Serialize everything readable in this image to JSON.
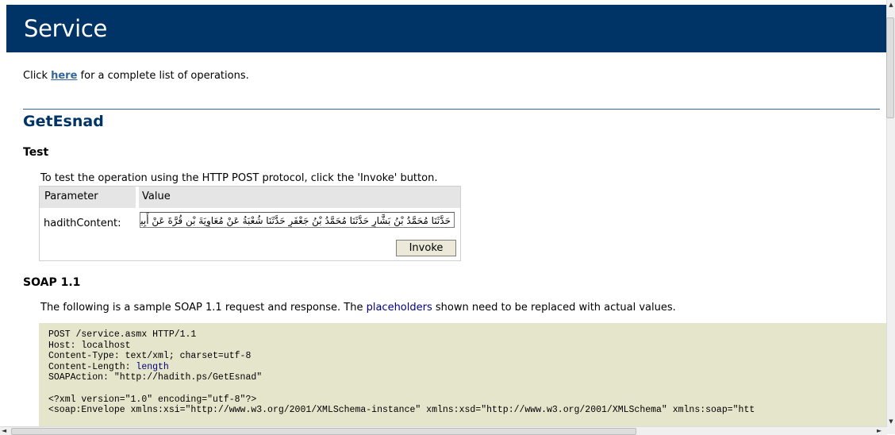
{
  "page": {
    "title": "Service",
    "intro": {
      "prefix": "Click ",
      "link": "here",
      "suffix": " for a complete list of operations."
    },
    "operation": "GetEsnad"
  },
  "test": {
    "heading": "Test",
    "description": "To test the operation using the HTTP POST protocol, click the 'Invoke' button.",
    "table": {
      "col_parameter": "Parameter",
      "col_value": "Value",
      "param_label": "hadithContent:",
      "param_value": "حَدَّثَنَا مُحَمَّدُ بْنُ بَشَّارٍ حَدَّثَنَا مُحَمَّدُ بْنُ جَعْفَرٍ حَدَّثَنَا شُعْبَةُ عَنْ مُعَاوِيَةَ بْنِ قُرَّةَ عَنْ أَبِيهِ."
    },
    "invoke_label": "Invoke"
  },
  "soap": {
    "heading": "SOAP 1.1",
    "desc_prefix": "The following is a sample SOAP 1.1 request and response. The ",
    "desc_link": "placeholders",
    "desc_suffix": " shown need to be replaced with actual values.",
    "code": {
      "line1": "POST /service.asmx HTTP/1.1",
      "line2": "Host: localhost",
      "line3": "Content-Type: text/xml; charset=utf-8",
      "line4_prefix": "Content-Length: ",
      "line4_value": "length",
      "line5": "SOAPAction: \"http://hadith.ps/GetEsnad\"",
      "line6": "",
      "line7": "<?xml version=\"1.0\" encoding=\"utf-8\"?>",
      "line8": "<soap:Envelope xmlns:xsi=\"http://www.w3.org/2001/XMLSchema-instance\" xmlns:xsd=\"http://www.w3.org/2001/XMLSchema\" xmlns:soap=\"htt"
    }
  },
  "scroll": {
    "up_icon": "▲",
    "down_icon": "▼",
    "left_icon": "◄",
    "right_icon": "►"
  }
}
